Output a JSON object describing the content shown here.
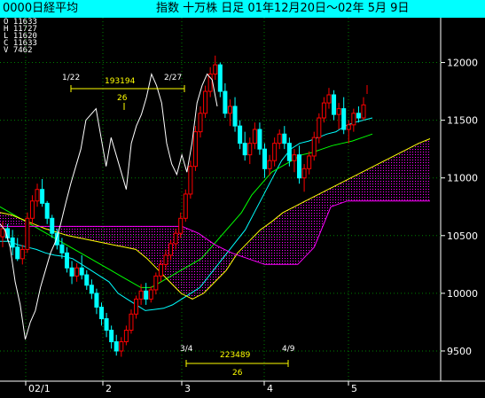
{
  "header": {
    "left": "0000日経平均",
    "right": "指数   十万株 日足 01年12月20日〜02年 5月 9日"
  },
  "ohlc_readout": [
    {
      "key": "O",
      "value": "11633"
    },
    {
      "key": "H",
      "value": "11727"
    },
    {
      "key": "L",
      "value": "11620"
    },
    {
      "key": "C",
      "value": "11633"
    },
    {
      "key": "V",
      "value": "7462"
    }
  ],
  "colors": {
    "background": "#000000",
    "header_bg": "#00FFFF",
    "candle_up": "#FF0000",
    "candle_down": "#00FFFF",
    "volume_line": "#FFFFFF",
    "ma_short": "#00FFFF",
    "ma_long": "#00FF00",
    "span_a": "#FFFF00",
    "span_b": "#FF00FF",
    "cloud_fill": "#FF00FF",
    "annotation": "#FFFF00",
    "grid": "#008000"
  },
  "chart_data": {
    "type": "candlestick",
    "title": "0000日経平均",
    "y_axis": {
      "ticks": [
        9500,
        10000,
        10500,
        11000,
        11500,
        12000
      ],
      "ylim": [
        9300,
        12250
      ],
      "position": "right"
    },
    "x_axis": {
      "ticks": [
        "02/1",
        "2",
        "3",
        "4",
        "5"
      ]
    },
    "latest": {
      "open": 11633,
      "high": 11727,
      "low": 11620,
      "close": 11633,
      "volume": 7462
    },
    "candles": [
      [
        10490,
        10620,
        10400,
        10560
      ],
      [
        10560,
        10600,
        10450,
        10480
      ],
      [
        10480,
        10550,
        10330,
        10400
      ],
      [
        10400,
        10480,
        10280,
        10300
      ],
      [
        10300,
        10420,
        10250,
        10380
      ],
      [
        10380,
        10700,
        10350,
        10650
      ],
      [
        10650,
        10850,
        10600,
        10800
      ],
      [
        10800,
        10950,
        10750,
        10900
      ],
      [
        10900,
        10990,
        10750,
        10780
      ],
      [
        10780,
        10800,
        10600,
        10650
      ],
      [
        10650,
        10680,
        10480,
        10520
      ],
      [
        10520,
        10560,
        10380,
        10420
      ],
      [
        10420,
        10480,
        10300,
        10350
      ],
      [
        10350,
        10400,
        10180,
        10220
      ],
      [
        10220,
        10280,
        10080,
        10150
      ],
      [
        10150,
        10260,
        10100,
        10220
      ],
      [
        10220,
        10330,
        10120,
        10160
      ],
      [
        10160,
        10200,
        10030,
        10070
      ],
      [
        10070,
        10120,
        9950,
        10000
      ],
      [
        10000,
        10040,
        9820,
        9880
      ],
      [
        9880,
        9920,
        9720,
        9780
      ],
      [
        9780,
        9830,
        9620,
        9680
      ],
      [
        9680,
        9720,
        9520,
        9580
      ],
      [
        9580,
        9640,
        9460,
        9500
      ],
      [
        9500,
        9620,
        9450,
        9580
      ],
      [
        9580,
        9720,
        9550,
        9680
      ],
      [
        9680,
        9860,
        9650,
        9820
      ],
      [
        9820,
        9980,
        9780,
        9950
      ],
      [
        9950,
        10080,
        9900,
        10020
      ],
      [
        10020,
        10090,
        9900,
        9950
      ],
      [
        9950,
        10060,
        9920,
        10030
      ],
      [
        10030,
        10180,
        9990,
        10150
      ],
      [
        10150,
        10290,
        10100,
        10250
      ],
      [
        10250,
        10380,
        10200,
        10330
      ],
      [
        10330,
        10460,
        10290,
        10430
      ],
      [
        10430,
        10560,
        10380,
        10520
      ],
      [
        10520,
        10700,
        10480,
        10650
      ],
      [
        10650,
        10900,
        10620,
        10860
      ],
      [
        10860,
        11150,
        10820,
        11100
      ],
      [
        11100,
        11450,
        11060,
        11400
      ],
      [
        11400,
        11620,
        11350,
        11560
      ],
      [
        11560,
        11800,
        11520,
        11750
      ],
      [
        11750,
        11960,
        11700,
        11900
      ],
      [
        11900,
        12060,
        11850,
        11980
      ],
      [
        11980,
        12000,
        11700,
        11750
      ],
      [
        11750,
        11820,
        11520,
        11560
      ],
      [
        11560,
        11680,
        11450,
        11620
      ],
      [
        11620,
        11700,
        11400,
        11450
      ],
      [
        11450,
        11500,
        11250,
        11300
      ],
      [
        11300,
        11400,
        11150,
        11200
      ],
      [
        11200,
        11350,
        11120,
        11300
      ],
      [
        11300,
        11480,
        11250,
        11420
      ],
      [
        11420,
        11480,
        11200,
        11250
      ],
      [
        11250,
        11300,
        11000,
        11080
      ],
      [
        11080,
        11200,
        11020,
        11150
      ],
      [
        11150,
        11350,
        11100,
        11300
      ],
      [
        11300,
        11420,
        11250,
        11380
      ],
      [
        11380,
        11450,
        11250,
        11300
      ],
      [
        11300,
        11350,
        11100,
        11150
      ],
      [
        11150,
        11250,
        11050,
        11200
      ],
      [
        11200,
        11280,
        10950,
        11000
      ],
      [
        11000,
        11120,
        10880,
        11080
      ],
      [
        11080,
        11230,
        11030,
        11190
      ],
      [
        11190,
        11400,
        11150,
        11350
      ],
      [
        11350,
        11560,
        11300,
        11520
      ],
      [
        11520,
        11700,
        11480,
        11650
      ],
      [
        11650,
        11780,
        11600,
        11720
      ],
      [
        11720,
        11760,
        11500,
        11550
      ],
      [
        11550,
        11650,
        11420,
        11600
      ],
      [
        11600,
        11700,
        11380,
        11420
      ],
      [
        11420,
        11500,
        11300,
        11460
      ],
      [
        11460,
        11600,
        11400,
        11560
      ],
      [
        11560,
        11620,
        11480,
        11520
      ],
      [
        11520,
        11700,
        11500,
        11633
      ]
    ],
    "volume_overlay": [
      10600,
      10550,
      10400,
      10100,
      9900,
      9600,
      9750,
      9850,
      10050,
      10200,
      10350,
      10450,
      10600,
      10780,
      10950,
      11100,
      11250,
      11500,
      11550,
      11600,
      11350,
      11100,
      11350,
      11200,
      11050,
      10900,
      11300,
      11450,
      11550,
      11700,
      11900,
      11800,
      11650,
      11300,
      11120,
      11030,
      11200,
      11050,
      11300,
      11650,
      11800,
      11900,
      11850,
      11620
    ],
    "series": [
      {
        "values": [
          10450,
          10450,
          10420,
          10400,
          10380,
          10350,
          10330,
          10320,
          10300,
          10250,
          10200,
          10150,
          10100,
          10000,
          9950,
          9900,
          9850,
          9860,
          9870,
          9900,
          9950,
          10000,
          10050,
          10150,
          10250,
          10350,
          10450,
          10550,
          10700,
          10850,
          11000,
          11150,
          11250,
          11300,
          11320,
          11350,
          11380,
          11400,
          11450,
          11480,
          11500,
          11520
        ]
      },
      {
        "values": [
          10750,
          10700,
          10650,
          10600,
          10550,
          10500,
          10450,
          10400,
          10350,
          10300,
          10250,
          10200,
          10150,
          10100,
          10050,
          10050,
          10100,
          10150,
          10200,
          10250,
          10300,
          10400,
          10500,
          10600,
          10700,
          10850,
          10950,
          11050,
          11100,
          11150,
          11200,
          11220,
          11250,
          11280,
          11300,
          11320,
          11350,
          11380
        ]
      },
      {
        "values": [
          10700,
          10680,
          10640,
          10600,
          10560,
          10530,
          10500,
          10480,
          10460,
          10440,
          10420,
          10400,
          10380,
          10300,
          10200,
          10100,
          10000,
          9950,
          10000,
          10100,
          10200,
          10350,
          10450,
          10550,
          10620,
          10700,
          10750,
          10800,
          10850,
          10900,
          10950,
          11000,
          11050,
          11100,
          11150,
          11200,
          11250,
          11300,
          11340
        ]
      },
      {
        "values": [
          10580,
          10580,
          10580,
          10580,
          10580,
          10580,
          10580,
          10580,
          10580,
          10580,
          10580,
          10580,
          10520,
          10420,
          10350,
          10300,
          10250,
          10250,
          10250,
          10400,
          10750,
          10800,
          10800,
          10800,
          10800,
          10800,
          10800
        ]
      }
    ],
    "annotations": [
      {
        "text": "1/22",
        "color": "#FFFFFF"
      },
      {
        "text": "193194",
        "color": "#FFFF00"
      },
      {
        "text": "26",
        "color": "#FFFF00"
      },
      {
        "text": "2/27",
        "color": "#FFFFFF"
      },
      {
        "text": "3/4",
        "color": "#FFFFFF"
      },
      {
        "text": "223489",
        "color": "#FFFF00"
      },
      {
        "text": "26",
        "color": "#FFFF00"
      },
      {
        "text": "4/9",
        "color": "#FFFFFF"
      }
    ]
  }
}
